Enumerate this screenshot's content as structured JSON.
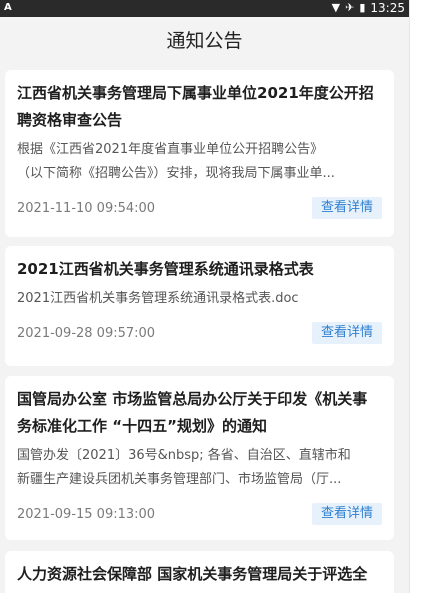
{
  "status_bar": {
    "left_label": "A",
    "time": "13:25"
  },
  "header": {
    "title": "通知公告"
  },
  "notices": [
    {
      "title_line1": "江西省机关事务管理局下属事业单位2021年度公开招",
      "title_line2": "聘资格审查公告",
      "desc_line1": "根据《江西省2021年度省直事业单位公开招聘公告》",
      "desc_line2": "（以下简称《招聘公告》）安排，现将我局下属事业单...",
      "date": "2021-11-10 09:54:00",
      "button": "查看详情"
    },
    {
      "title_line1": "2021江西省机关事务管理系统通讯录格式表",
      "desc_line1": "2021江西省机关事务管理系统通讯录格式表.doc",
      "date": "2021-09-28 09:57:00",
      "button": "查看详情"
    },
    {
      "title_line1": "国管局办公室 市场监管总局办公厅关于印发《机关事",
      "title_line2": "务标准化工作 “十四五”规划》的通知",
      "desc_line1": "国管办发〔2021〕36号&nbsp; 各省、自治区、直辖市和",
      "desc_line2": "新疆生产建设兵团机关事务管理部门、市场监管局（厅...",
      "date": "2021-09-15 09:13:00",
      "button": "查看详情"
    },
    {
      "title_line1": "人力资源社会保障部 国家机关事务管理局关于评选全"
    }
  ]
}
